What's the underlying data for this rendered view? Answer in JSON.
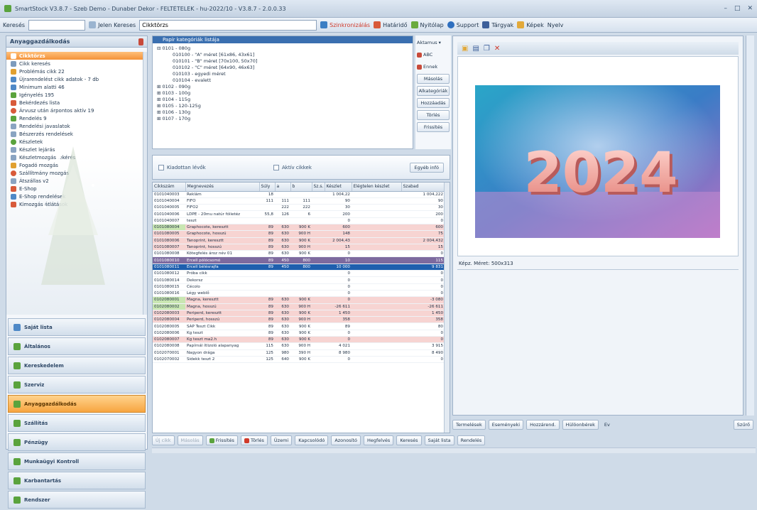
{
  "window": {
    "title": "SmartStock V3.8.7 - Szeb Demo - Dunaber Dekor - FELTÉTELEK - hu-2022/10 - V3.8.7 - 2.0.0.33"
  },
  "toolbar": {
    "search_label": "Keresés",
    "search_value": "",
    "search_btn": "Jelen Kereses",
    "field_value": "Cikktörzs",
    "items": [
      "Szinkronizálás",
      "Határidő",
      "Nyitólap",
      "Support",
      "Tárgyak",
      "Képek",
      "Nyelv"
    ]
  },
  "left": {
    "header": "Anyaggazdálkodás",
    "items": [
      "Cikktörzs",
      "Cikk keresés",
      "Problémás cikk 22",
      "Újrarendelést cikk adatok - 7 db",
      "Minimum alatti 46",
      "Igényelés 195",
      "Bekérdezés lista",
      "Árvusz után árpontos aktív 19",
      "Rendelés 9",
      "Rendelési javaslatok",
      "Bészerzés rendelések",
      "Készletek",
      "Készlet lejárás",
      "Készletmozgás lekérés",
      "Fogadó mozgás",
      "Szállítmány mozgás",
      "Átszállas v2",
      "E-Shop",
      "E-Shop rendelések",
      "Kimozgás átlátások"
    ],
    "sections": [
      "Saját lista",
      "Általános",
      "Kereskedelem",
      "Szerviz",
      "Anyaggazdálkodás",
      "Szállítás",
      "Pénzügy",
      "Munkaügyi Kontroll",
      "Karbantartás",
      "Rendszer"
    ]
  },
  "tree": {
    "header": "Papír kategóriák listája",
    "rows": [
      "0101 - 080g",
      "010100 - \"A\" méret [61x86, 43x61]",
      "010101 - \"B\" méret [70x100, 50x70]",
      "010102 - \"C\" méret [64x90, 46x63]",
      "010103 - egyedi méret",
      "010104 - evalett",
      "0102 - 090g",
      "0103 - 100g",
      "0104 - 115g",
      "0105 - 120-125g",
      "0106 - 130g",
      "0107 - 170g"
    ]
  },
  "side_buttons": [
    "Aktamus",
    "ABC",
    "Ennek",
    "Másolás",
    "Alkategóriák",
    "Hozzáadás",
    "Törlés",
    "Frissítés"
  ],
  "filters": {
    "opt1": "Kiadottan lévők",
    "opt2": "Aktív cikkek",
    "btn": "Egyéb infó"
  },
  "columns": [
    "Cikkszám",
    "Megnevezés",
    "Súly",
    "a",
    "b",
    "Sz.s.",
    "Készlet",
    "Elégtelen készlet",
    "Szabad"
  ],
  "rows": [
    {
      "c": [
        "0101040003",
        "Reklám",
        "18",
        "",
        "",
        "",
        "1 004,22",
        "",
        "1 004,222"
      ],
      "t": ""
    },
    {
      "c": [
        "0101040004",
        "FIFO",
        "111",
        "111",
        "111",
        "",
        "90",
        "",
        "90"
      ],
      "t": ""
    },
    {
      "c": [
        "0101040005",
        "FIFO2",
        "",
        "222",
        "222",
        "",
        "30",
        "",
        "30"
      ],
      "t": ""
    },
    {
      "c": [
        "0101040006",
        "LDPE - 20mu natúr fólietéz",
        "55,8",
        "126",
        "6",
        "",
        "200",
        "",
        "200"
      ],
      "t": ""
    },
    {
      "c": [
        "0101040007",
        "teszt",
        "",
        "",
        "",
        "",
        "0",
        "",
        "0"
      ],
      "t": ""
    },
    {
      "c": [
        "0101080004",
        "Graphocote, keresztt",
        "89",
        "630",
        "900 K",
        "",
        "600",
        "",
        "600"
      ],
      "t": "pink green"
    },
    {
      "c": [
        "0101080005",
        "Graphocote, hosszú",
        "89",
        "630",
        "900 H",
        "",
        "148",
        "",
        "75"
      ],
      "t": "pink"
    },
    {
      "c": [
        "0101080006",
        "Tanoprint, keresztt",
        "89",
        "630",
        "900 K",
        "",
        "2 004,43",
        "",
        "2 004,432"
      ],
      "t": "pink"
    },
    {
      "c": [
        "0101080007",
        "Tanoprint, hosszú",
        "89",
        "630",
        "900 H",
        "",
        "15",
        "",
        "15"
      ],
      "t": "pink"
    },
    {
      "c": [
        "0101080008",
        "Kötegfelés ároz név 01",
        "89",
        "630",
        "900 K",
        "",
        "0",
        "",
        "0"
      ],
      "t": ""
    },
    {
      "c": [
        "0101080010",
        "Ercell pólócsomó",
        "89",
        "450",
        "800",
        "",
        "10",
        "",
        "115"
      ],
      "t": "purple"
    },
    {
      "c": [
        "0101080011",
        "Ercell bélésrajfa",
        "89",
        "450",
        "800",
        "",
        "10 000",
        "",
        "9 831"
      ],
      "t": "blue"
    },
    {
      "c": [
        "0101080012",
        "Próba cikk",
        "",
        "",
        "",
        "",
        "0",
        "",
        "0"
      ],
      "t": ""
    },
    {
      "c": [
        "0101080014",
        "Dekorsz",
        "",
        "",
        "",
        "",
        "0",
        "",
        "0"
      ],
      "t": ""
    },
    {
      "c": [
        "0101080015",
        "Cécolo",
        "",
        "",
        "",
        "",
        "0",
        "",
        "0"
      ],
      "t": ""
    },
    {
      "c": [
        "0101080016",
        "Légy weblő",
        "",
        "",
        "",
        "",
        "0",
        "",
        "0"
      ],
      "t": ""
    },
    {
      "c": [
        "0102080001",
        "Magna, keresztt",
        "89",
        "630",
        "900 K",
        "",
        "0",
        "",
        "-3 080"
      ],
      "t": "pink green"
    },
    {
      "c": [
        "0102080002",
        "Magna, hosszú",
        "89",
        "630",
        "900 H",
        "",
        "-26 611",
        "",
        "-26 611"
      ],
      "t": "pink green"
    },
    {
      "c": [
        "0102080003",
        "Periperd, keresztt",
        "89",
        "630",
        "900 K",
        "",
        "1 450",
        "",
        "1 450"
      ],
      "t": "pink"
    },
    {
      "c": [
        "0102080004",
        "Periperd, hosszú",
        "89",
        "630",
        "900 H",
        "",
        "358",
        "",
        "358"
      ],
      "t": "pink"
    },
    {
      "c": [
        "0102080005",
        "SAP Teszt Cikk",
        "89",
        "630",
        "900 K",
        "",
        "89",
        "",
        "80"
      ],
      "t": ""
    },
    {
      "c": [
        "0102080006",
        "Kg teszt",
        "89",
        "630",
        "900 K",
        "",
        "0",
        "",
        "0"
      ],
      "t": ""
    },
    {
      "c": [
        "0102080007",
        "Kg teszt ma2.h",
        "89",
        "630",
        "900 K",
        "",
        "0",
        "",
        "0"
      ],
      "t": "pink"
    },
    {
      "c": [
        "0102080008",
        "Papírnál ítlizoló alapanyag",
        "115",
        "630",
        "900 H",
        "",
        "4 021",
        "",
        "3 915"
      ],
      "t": ""
    },
    {
      "c": [
        "0102070001",
        "Nagyon drága",
        "125",
        "980",
        "390 H",
        "",
        "8 980",
        "",
        "8 490"
      ],
      "t": ""
    },
    {
      "c": [
        "0102070002",
        "Sidekk teszt 2",
        "125",
        "640",
        "900 K",
        "",
        "0",
        "",
        "0"
      ],
      "t": ""
    }
  ],
  "preview": {
    "image_text": "2024",
    "info": "Képz. Méret: 500x313"
  },
  "bottom_buttons": [
    "Termelések",
    "Eseményeki",
    "Hozzárend.",
    "Hülöonbérek",
    "Ev",
    "Szűrő"
  ],
  "footer": [
    "Új cikk",
    "Másolás",
    "Frissítés",
    "Törlés",
    "Üzemi",
    "Kapcsolódó",
    "Azonosító",
    "Hegfelvés",
    "Keresés",
    "Saját lista",
    "Rendelés"
  ]
}
